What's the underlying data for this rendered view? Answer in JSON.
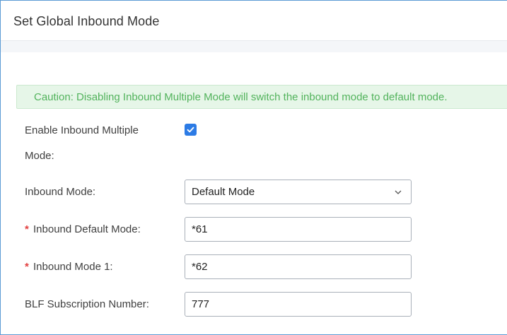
{
  "dialog": {
    "title": "Set Global Inbound Mode",
    "caution": "Caution: Disabling Inbound Multiple Mode will switch the inbound mode to default mode."
  },
  "form": {
    "enable_multiple": {
      "label_line1": "Enable Inbound Multiple",
      "label_line2": "Mode:",
      "checked": true
    },
    "inbound_mode": {
      "label": "Inbound Mode:",
      "value": "Default Mode"
    },
    "inbound_default_mode": {
      "required_mark": "*",
      "label": "Inbound Default Mode:",
      "value": "*61"
    },
    "inbound_mode_1": {
      "required_mark": "*",
      "label": "Inbound Mode 1:",
      "value": "*62"
    },
    "blf_subscription": {
      "label": "BLF Subscription Number:",
      "value": "777"
    }
  },
  "icons": {
    "checkbox": "check-icon",
    "dropdown": "chevron-down-icon"
  },
  "colors": {
    "accent": "#2c7be5",
    "caution_text": "#52b35c",
    "caution_bg": "#e6f6e8",
    "required": "#e24040",
    "dialog_border": "#5b9bd5"
  }
}
